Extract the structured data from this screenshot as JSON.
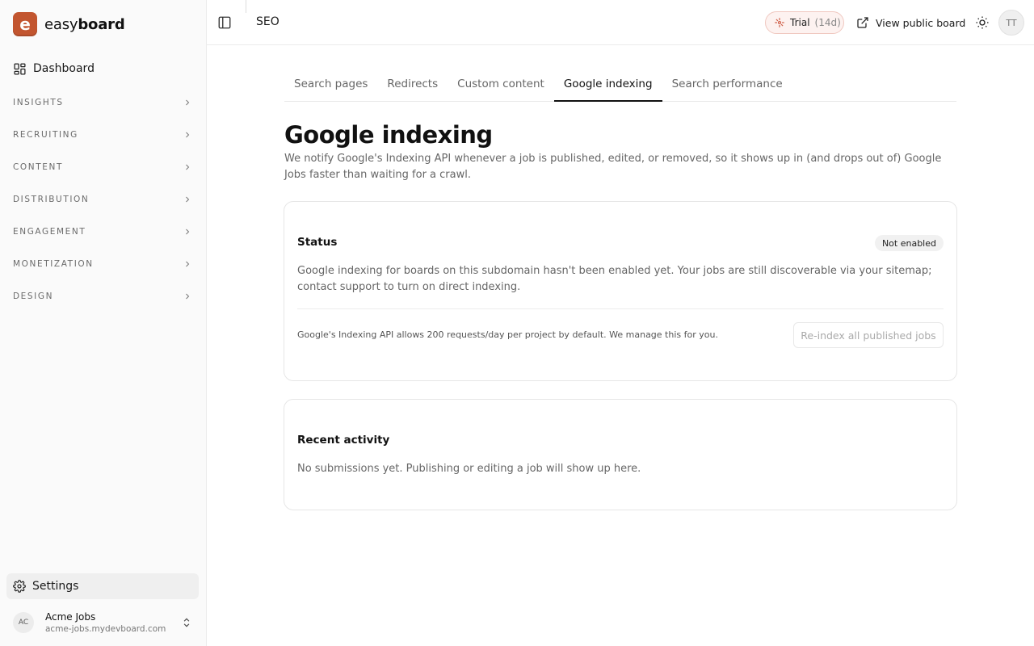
{
  "brand": {
    "logo_letter": "e",
    "name_light": "easy",
    "name_bold": "board",
    "logo_color": "#c2552f"
  },
  "sidebar": {
    "dashboard_label": "Dashboard",
    "sections": [
      {
        "label": "INSIGHTS"
      },
      {
        "label": "RECRUITING"
      },
      {
        "label": "CONTENT"
      },
      {
        "label": "DISTRIBUTION"
      },
      {
        "label": "ENGAGEMENT"
      },
      {
        "label": "MONETIZATION"
      },
      {
        "label": "DESIGN"
      }
    ],
    "settings_label": "Settings",
    "account": {
      "initials": "AC",
      "name": "Acme Jobs",
      "domain": "acme-jobs.mydevboard.com"
    }
  },
  "header": {
    "breadcrumb": "SEO",
    "trial": {
      "label": "Trial",
      "days": "(14d)"
    },
    "view_public_label": "View public board",
    "user_initials": "TT"
  },
  "tabs": [
    {
      "label": "Search pages",
      "active": false
    },
    {
      "label": "Redirects",
      "active": false
    },
    {
      "label": "Custom content",
      "active": false
    },
    {
      "label": "Google indexing",
      "active": true
    },
    {
      "label": "Search performance",
      "active": false
    }
  ],
  "page": {
    "title": "Google indexing",
    "description": "We notify Google's Indexing API whenever a job is published, edited, or removed, so it shows up in (and drops out of) Google Jobs faster than waiting for a crawl."
  },
  "status_card": {
    "heading": "Status",
    "badge": "Not enabled",
    "body": "Google indexing for boards on this subdomain hasn't been enabled yet. Your jobs are still discoverable via your sitemap; contact support to turn on direct indexing.",
    "quota_note": "Google's Indexing API allows 200 requests/day per project by default. We manage this for you.",
    "reindex_button": "Re-index all published jobs"
  },
  "activity_card": {
    "heading": "Recent activity",
    "empty_text": "No submissions yet. Publishing or editing a job will show up here."
  }
}
